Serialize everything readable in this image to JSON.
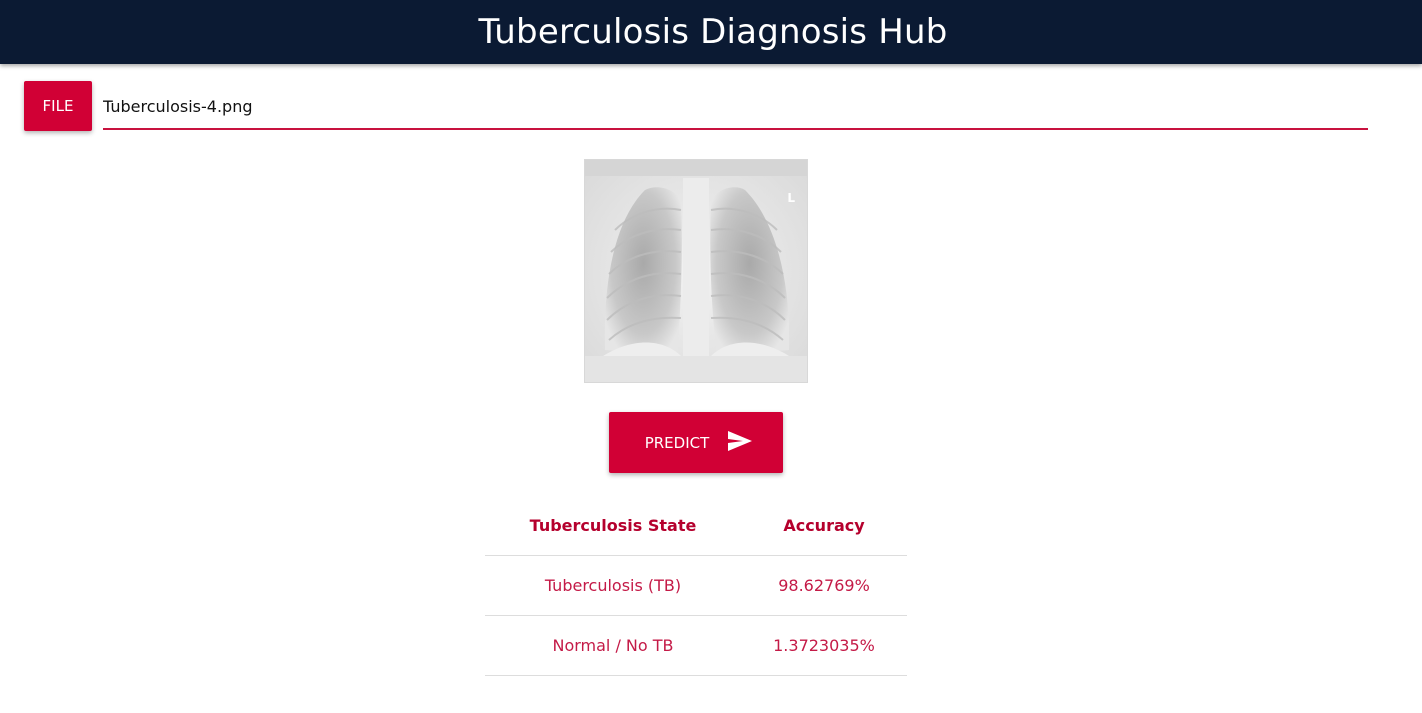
{
  "header": {
    "title": "Tuberculosis Diagnosis Hub"
  },
  "file_input": {
    "button_label": "FILE",
    "file_name": "Tuberculosis-4.png"
  },
  "preview": {
    "marker": "L"
  },
  "predict": {
    "label": "PREDICT",
    "icon": "send-icon"
  },
  "results": {
    "columns": [
      "Tuberculosis State",
      "Accuracy"
    ],
    "rows": [
      {
        "state": "Tuberculosis (TB)",
        "accuracy": "98.62769%"
      },
      {
        "state": "Normal / No TB",
        "accuracy": "1.3723035%"
      }
    ]
  },
  "colors": {
    "appbar": "#0b1a33",
    "accent": "#d10035",
    "table_text": "#c41a47"
  }
}
